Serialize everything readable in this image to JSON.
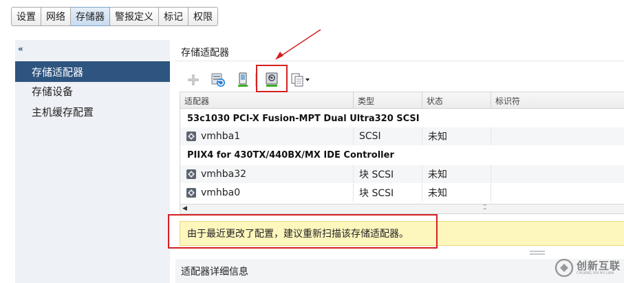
{
  "tabs": [
    {
      "label": "设置"
    },
    {
      "label": "网络"
    },
    {
      "label": "存储器",
      "active": true
    },
    {
      "label": "警报定义"
    },
    {
      "label": "标记"
    },
    {
      "label": "权限"
    }
  ],
  "sidebar": {
    "collapse_glyph": "«",
    "items": [
      {
        "label": "存储适配器",
        "active": true
      },
      {
        "label": "存储设备"
      },
      {
        "label": "主机缓存配置"
      }
    ]
  },
  "main": {
    "title": "存储适配器",
    "toolbar": {
      "icons": [
        "add-icon",
        "rescan-storage-icon",
        "rescan-adapter-icon",
        "rescan-vmfs-icon",
        "copy-settings-icon"
      ]
    },
    "table": {
      "columns": [
        "适配器",
        "类型",
        "状态",
        "标识符"
      ],
      "groups": [
        {
          "name": "53c1030 PCI-X Fusion-MPT Dual Ultra320 SCSI",
          "rows": [
            {
              "adapter": "vmhba1",
              "type": "SCSI",
              "status": "未知",
              "identifier": ""
            }
          ]
        },
        {
          "name": "PIIX4 for 430TX/440BX/MX IDE Controller",
          "rows": [
            {
              "adapter": "vmhba32",
              "type": "块 SCSI",
              "status": "未知",
              "identifier": ""
            },
            {
              "adapter": "vmhba0",
              "type": "块 SCSI",
              "status": "未知",
              "identifier": ""
            }
          ]
        }
      ]
    },
    "notice": "由于最近更改了配置，建议重新扫描该存储适配器。",
    "details_title": "适配器详细信息"
  },
  "watermark": {
    "main": "创新互联",
    "sub": "CHUANG XIN HU LIAN"
  },
  "colors": {
    "nav_active": "#2e5580",
    "notice_bg": "#fdf6bd",
    "annotation": "#d42020"
  }
}
